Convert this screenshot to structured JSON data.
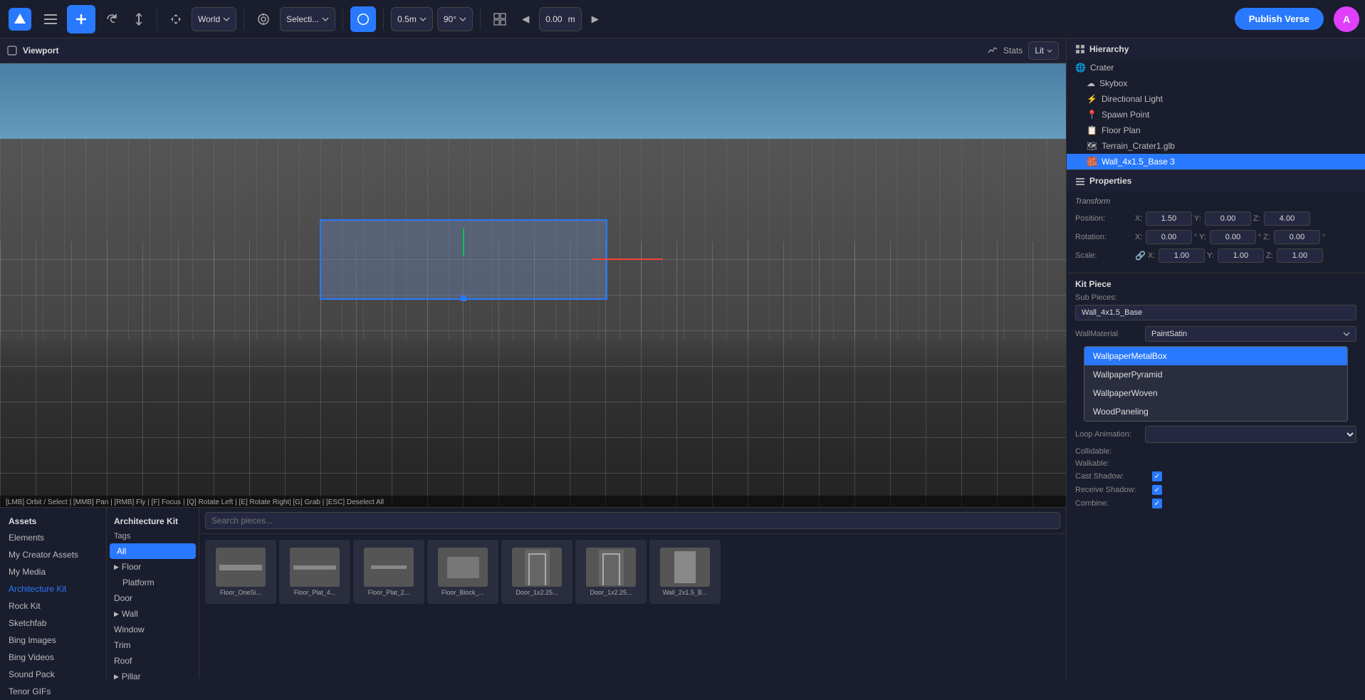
{
  "toolbar": {
    "world_label": "World",
    "selection_label": "Selecti...",
    "snap_label": "0.5m",
    "angle_label": "90°",
    "offset_label": "0.00",
    "offset_unit": "m",
    "publish_label": "Publish Verse",
    "user_initial": "A"
  },
  "viewport": {
    "title": "Viewport",
    "stats_label": "Stats",
    "lit_label": "Lit",
    "hint": "[LMB] Orbit / Select | [MMB] Pan | [RMB] Fly | [F] Focus | [Q] Rotate Left | [E] Rotate Right| [G] Grab | [ESC] Deselect All"
  },
  "hierarchy": {
    "title": "Hierarchy",
    "items": [
      {
        "label": "Crater",
        "level": 0,
        "icon": "🌐"
      },
      {
        "label": "Skybox",
        "level": 1,
        "icon": "☁"
      },
      {
        "label": "Directional Light",
        "level": 1,
        "icon": "⚡"
      },
      {
        "label": "Spawn Point",
        "level": 1,
        "icon": "📍"
      },
      {
        "label": "Floor Plan",
        "level": 1,
        "icon": "📋"
      },
      {
        "label": "Terrain_Crater1.glb",
        "level": 1,
        "icon": "🗺"
      },
      {
        "label": "Wall_4x1.5_Base 3",
        "level": 1,
        "icon": "🧱",
        "active": true
      }
    ]
  },
  "properties": {
    "title": "Properties",
    "transform_label": "Transform",
    "position": {
      "x": "1.50",
      "y": "0.00",
      "z": "4.00"
    },
    "rotation": {
      "x": "0.00",
      "y": "0.00",
      "z": "0.00"
    },
    "scale": {
      "x": "1.00",
      "y": "1.00",
      "z": "1.00"
    }
  },
  "kit_piece": {
    "title": "Kit Piece",
    "sub_pieces_label": "Sub Pieces:",
    "sub_pieces_value": "Wall_4x1.5_Base",
    "wall_material_label": "WallMaterial",
    "wall_material_value": "PaintSatin",
    "loop_animation_label": "Loop Animation:",
    "collidable_label": "Collidable:",
    "walkable_label": "Walkable:",
    "cast_shadow_label": "Cast Shadow:",
    "receive_shadow_label": "Receive Shadow:",
    "combine_label": "Combine:"
  },
  "dropdown_items": [
    {
      "label": "WallpaperMetalBox",
      "highlighted": true
    },
    {
      "label": "WallpaperPyramid",
      "highlighted": false
    },
    {
      "label": "WallpaperWoven",
      "highlighted": false
    },
    {
      "label": "WoodPaneling",
      "highlighted": false
    }
  ],
  "assets": {
    "panel_title": "Assets",
    "sidebar_items": [
      {
        "label": "Elements",
        "active": false
      },
      {
        "label": "My Creator Assets",
        "active": false
      },
      {
        "label": "My Media",
        "active": false
      },
      {
        "label": "Architecture Kit",
        "active": true
      },
      {
        "label": "Rock Kit",
        "active": false
      },
      {
        "label": "Sketchfab",
        "active": false
      },
      {
        "label": "Bing Images",
        "active": false
      },
      {
        "label": "Bing Videos",
        "active": false
      },
      {
        "label": "Sound Pack",
        "active": false
      },
      {
        "label": "Tenor GIFs",
        "active": false
      }
    ],
    "category_title": "Architecture Kit",
    "tags_title": "Tags",
    "tags": [
      {
        "label": "All",
        "active": true,
        "has_children": false
      },
      {
        "label": "Floor",
        "active": false,
        "has_children": true
      },
      {
        "label": "Platform",
        "active": false,
        "has_children": false
      },
      {
        "label": "Door",
        "active": false,
        "has_children": false
      },
      {
        "label": "Wall",
        "active": false,
        "has_children": true
      },
      {
        "label": "Window",
        "active": false,
        "has_children": false
      },
      {
        "label": "Trim",
        "active": false,
        "has_children": false
      },
      {
        "label": "Roof",
        "active": false,
        "has_children": false
      },
      {
        "label": "Pillar",
        "active": false,
        "has_children": true
      }
    ],
    "search_placeholder": "Search pieces...",
    "thumbs": [
      {
        "label": "Floor_OneSi..."
      },
      {
        "label": "Floor_Plat_4..."
      },
      {
        "label": "Floor_Plat_2..."
      },
      {
        "label": "Floor_Block_..."
      },
      {
        "label": "Door_1x2.25..."
      },
      {
        "label": "Door_1x2.25..."
      },
      {
        "label": "Wall_2x1.5_B..."
      }
    ]
  }
}
